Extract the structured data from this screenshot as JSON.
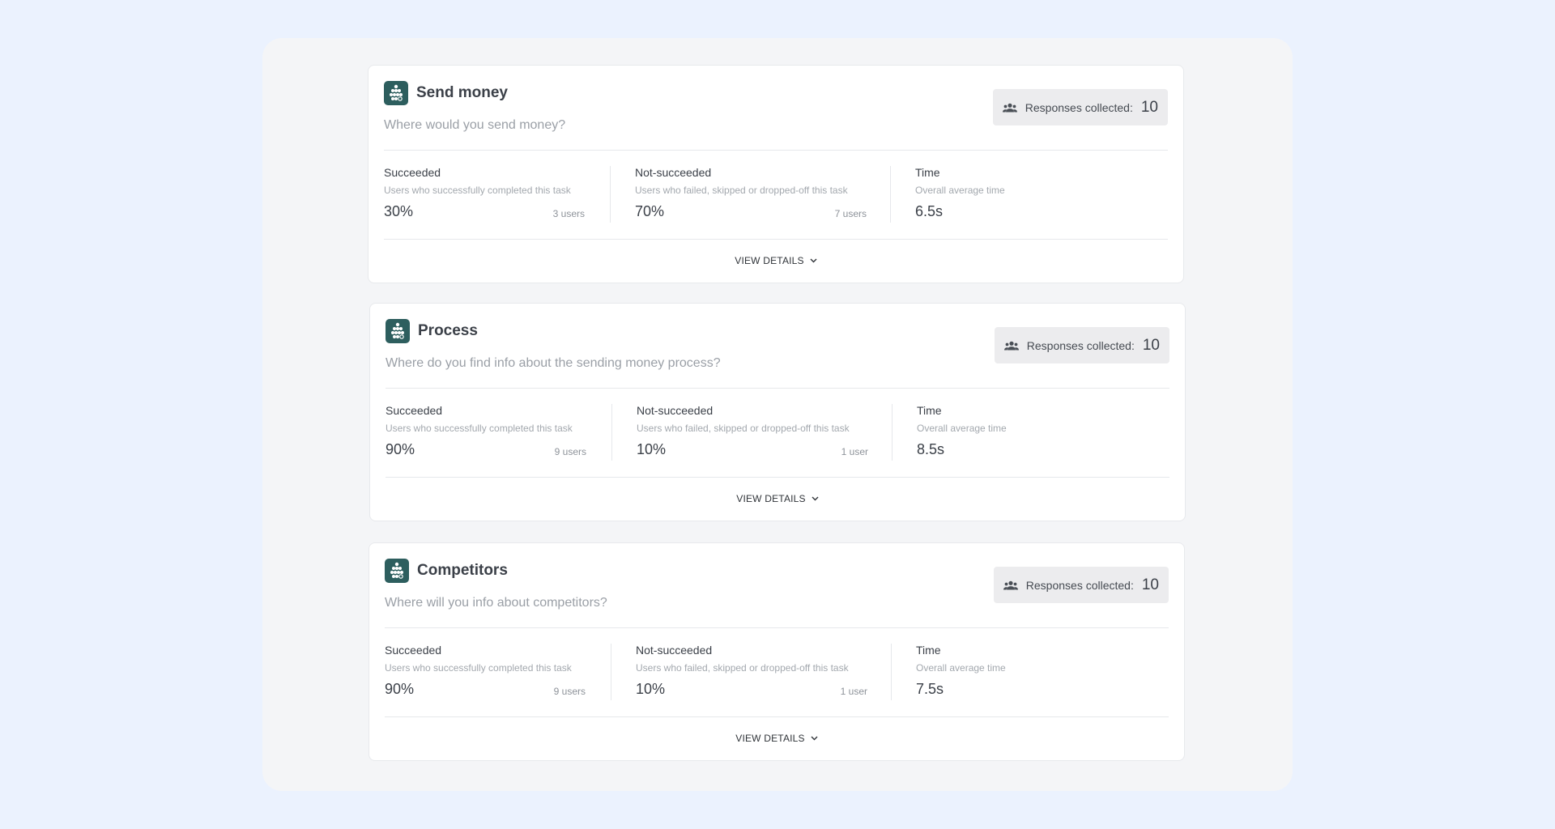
{
  "tasks": [
    {
      "title": "Send money",
      "question": "Where would you send money?",
      "responses_label": "Responses collected:",
      "responses_count": "10",
      "succeeded": {
        "title": "Succeeded",
        "desc": "Users who successfully completed this task",
        "value": "30%",
        "users": "3 users"
      },
      "not_succeeded": {
        "title": "Not-succeeded",
        "desc": "Users who failed, skipped or dropped-off this task",
        "value": "70%",
        "users": "7 users"
      },
      "time": {
        "title": "Time",
        "desc": "Overall average time",
        "value": "6.5s"
      },
      "view_details": "VIEW DETAILS"
    },
    {
      "title": "Process",
      "question": "Where do you find info about the sending money process?",
      "responses_label": "Responses collected:",
      "responses_count": "10",
      "succeeded": {
        "title": "Succeeded",
        "desc": "Users who successfully completed this task",
        "value": "90%",
        "users": "9 users"
      },
      "not_succeeded": {
        "title": "Not-succeeded",
        "desc": "Users who failed, skipped or dropped-off this task",
        "value": "10%",
        "users": "1 user"
      },
      "time": {
        "title": "Time",
        "desc": "Overall average time",
        "value": "8.5s"
      },
      "view_details": "VIEW DETAILS"
    },
    {
      "title": "Competitors",
      "question": "Where will you info about competitors?",
      "responses_label": "Responses collected:",
      "responses_count": "10",
      "succeeded": {
        "title": "Succeeded",
        "desc": "Users who successfully completed this task",
        "value": "90%",
        "users": "9 users"
      },
      "not_succeeded": {
        "title": "Not-succeeded",
        "desc": "Users who failed, skipped or dropped-off this task",
        "value": "10%",
        "users": "1 user"
      },
      "time": {
        "title": "Time",
        "desc": "Overall average time",
        "value": "7.5s"
      },
      "view_details": "VIEW DETAILS"
    }
  ],
  "icons": {
    "task": "tree-test-icon",
    "responses": "people-icon",
    "view_details": "chevron-down-icon"
  },
  "colors": {
    "background": "#ebf2fe",
    "panel": "#f4f5f7",
    "card": "#ffffff",
    "task_icon": "#2d5e5e",
    "responses_badge": "#ececee"
  }
}
